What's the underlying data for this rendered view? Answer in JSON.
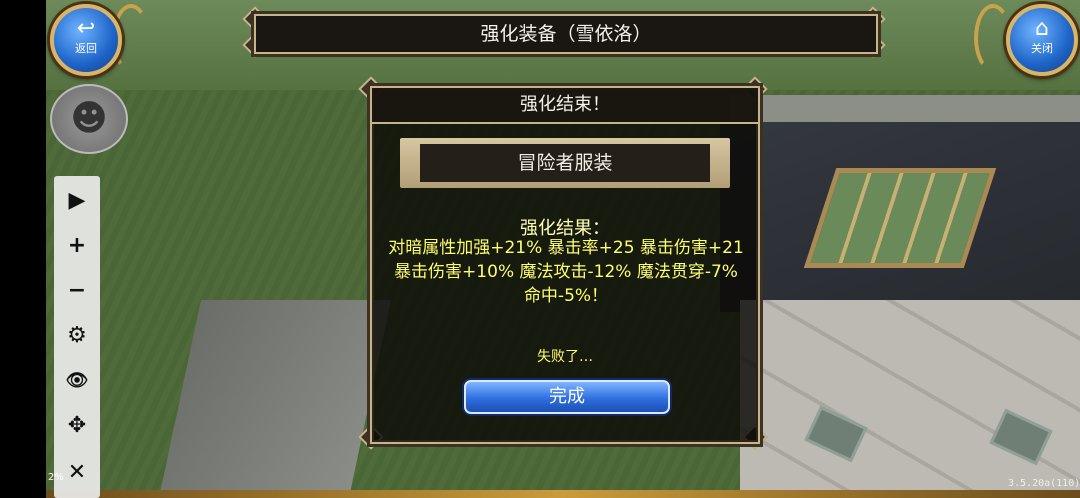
{
  "buttons": {
    "back": {
      "label": "返回",
      "icon": "back-arrow-icon"
    },
    "close": {
      "label": "关闭",
      "icon": "home-icon"
    }
  },
  "title": "强化装备（雪依洛）",
  "dialog": {
    "header": "强化结束！",
    "item_name": "冒险者服装",
    "result_title": "强化结果：",
    "result_text": "对暗属性加强+21% 暴击率+25 暴击伤害+21 暴击伤害+10% 魔法攻击-12% 魔法贯穿-7% 命中-5%！",
    "status": "失败了…",
    "done_label": "完成"
  },
  "toolbar": [
    {
      "name": "play",
      "glyph": "▶"
    },
    {
      "name": "zoom-in",
      "glyph": "+"
    },
    {
      "name": "zoom-out",
      "glyph": "−"
    },
    {
      "name": "settings",
      "glyph": "⚙"
    },
    {
      "name": "eye",
      "glyph": "👁"
    },
    {
      "name": "move",
      "glyph": "✥"
    },
    {
      "name": "close",
      "glyph": "✕"
    }
  ],
  "zoom_indicator": "2%",
  "version": "3.5.20a(110)",
  "colors": {
    "accent_gold": "#c8b48a",
    "button_blue": "#2f6fe0",
    "result_yellow": "#ffff6a"
  }
}
